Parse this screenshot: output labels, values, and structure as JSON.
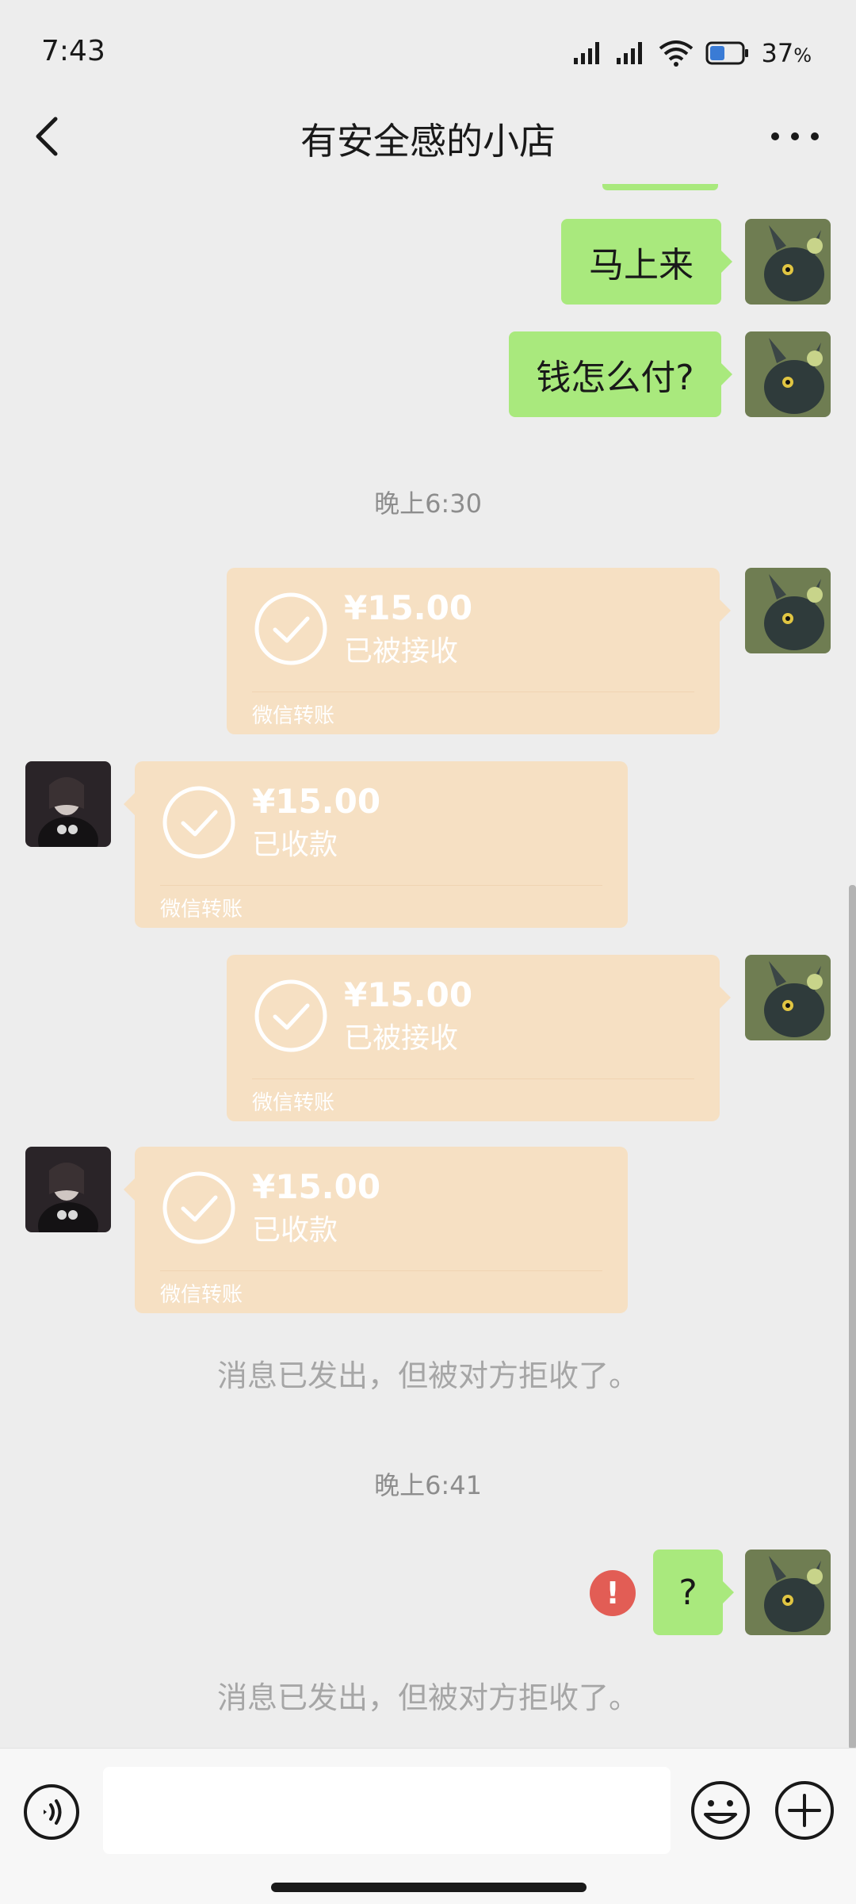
{
  "status_bar": {
    "time": "7:43",
    "battery": "37",
    "battery_unit": "%"
  },
  "header": {
    "title": "有安全感的小店"
  },
  "messages": [
    {
      "type": "text",
      "side": "right",
      "text": "马上来"
    },
    {
      "type": "text",
      "side": "right",
      "text": "钱怎么付?"
    },
    {
      "type": "timestamp",
      "text": "晚上6:30"
    },
    {
      "type": "transfer",
      "side": "right",
      "amount": "¥15.00",
      "status": "已被接收",
      "footer": "微信转账"
    },
    {
      "type": "transfer",
      "side": "left",
      "amount": "¥15.00",
      "status": "已收款",
      "footer": "微信转账"
    },
    {
      "type": "transfer",
      "side": "right",
      "amount": "¥15.00",
      "status": "已被接收",
      "footer": "微信转账"
    },
    {
      "type": "transfer",
      "side": "left",
      "amount": "¥15.00",
      "status": "已收款",
      "footer": "微信转账"
    },
    {
      "type": "notice",
      "text": "消息已发出，但被对方拒收了。"
    },
    {
      "type": "timestamp",
      "text": "晚上6:41"
    },
    {
      "type": "text",
      "side": "right",
      "text": "?",
      "error": "!"
    },
    {
      "type": "notice",
      "text": "消息已发出，但被对方拒收了。"
    }
  ],
  "input": {
    "value": ""
  },
  "colors": {
    "self_bubble": "#a9e97d",
    "transfer_card": "#f6e0c3",
    "error": "#e25d55",
    "background": "#ededed"
  },
  "icons": {
    "back": "back-arrow-icon",
    "more": "more-dots-icon",
    "voice": "voice-icon",
    "emoji": "emoji-icon",
    "plus": "plus-icon",
    "check": "check-circle-icon"
  }
}
